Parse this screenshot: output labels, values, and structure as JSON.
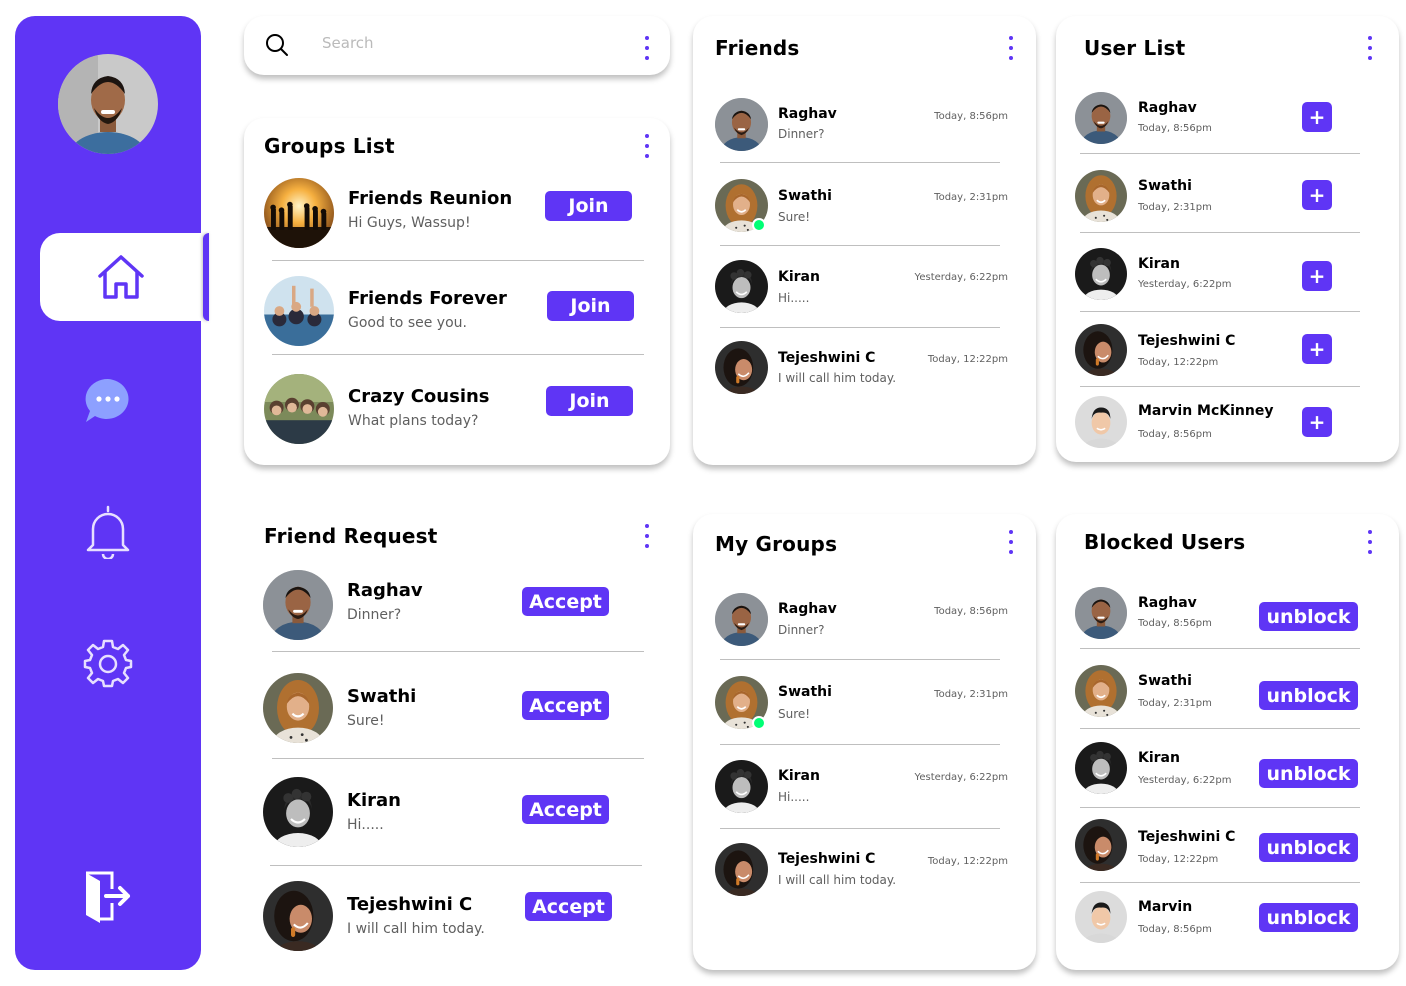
{
  "search": {
    "placeholder": "Search"
  },
  "groups_list": {
    "title": "Groups List",
    "items": [
      {
        "name": "Friends Reunion",
        "message": "Hi Guys, Wassup!",
        "action": "Join"
      },
      {
        "name": "Friends Forever",
        "message": "Good to see you.",
        "action": "Join"
      },
      {
        "name": "Crazy Cousins",
        "message": "What plans today?",
        "action": "Join"
      }
    ]
  },
  "friends": {
    "title": "Friends",
    "items": [
      {
        "name": "Raghav",
        "message": "Dinner?",
        "time": "Today, 8:56pm"
      },
      {
        "name": "Swathi",
        "message": "Sure!",
        "time": "Today, 2:31pm"
      },
      {
        "name": "Kiran",
        "message": "Hi.....",
        "time": "Yesterday, 6:22pm"
      },
      {
        "name": "Tejeshwini C",
        "message": "I will call him today.",
        "time": "Today, 12:22pm"
      }
    ]
  },
  "user_list": {
    "title": "User List",
    "items": [
      {
        "name": "Raghav",
        "time": "Today, 8:56pm",
        "action": "+"
      },
      {
        "name": "Swathi",
        "time": "Today, 2:31pm",
        "action": "+"
      },
      {
        "name": "Kiran",
        "time": "Yesterday, 6:22pm",
        "action": "+"
      },
      {
        "name": "Tejeshwini C",
        "time": "Today, 12:22pm",
        "action": "+"
      },
      {
        "name": "Marvin McKinney",
        "time": "Today, 8:56pm",
        "action": "+"
      }
    ]
  },
  "friend_request": {
    "title": "Friend  Request",
    "items": [
      {
        "name": "Raghav",
        "message": "Dinner?",
        "action": "Accept"
      },
      {
        "name": "Swathi",
        "message": "Sure!",
        "action": "Accept"
      },
      {
        "name": "Kiran",
        "message": "Hi.....",
        "action": "Accept"
      },
      {
        "name": "Tejeshwini C",
        "message": "I will call him today.",
        "action": "Accept"
      }
    ]
  },
  "my_groups": {
    "title": "My Groups",
    "items": [
      {
        "name": "Raghav",
        "message": "Dinner?",
        "time": "Today, 8:56pm"
      },
      {
        "name": "Swathi",
        "message": "Sure!",
        "time": "Today, 2:31pm"
      },
      {
        "name": "Kiran",
        "message": "Hi.....",
        "time": "Yesterday, 6:22pm"
      },
      {
        "name": "Tejeshwini C",
        "message": "I will call him today.",
        "time": "Today, 12:22pm"
      }
    ]
  },
  "blocked_users": {
    "title": "Blocked Users",
    "items": [
      {
        "name": "Raghav",
        "time": "Today, 8:56pm",
        "action": "unblock"
      },
      {
        "name": "Swathi",
        "time": "Today, 2:31pm",
        "action": "unblock"
      },
      {
        "name": "Kiran",
        "time": "Yesterday, 6:22pm",
        "action": "unblock"
      },
      {
        "name": "Tejeshwini C",
        "time": "Today, 12:22pm",
        "action": "unblock"
      },
      {
        "name": "Marvin",
        "time": "Today, 8:56pm",
        "action": "unblock"
      }
    ]
  },
  "colors": {
    "accent": "#5f35f5",
    "online": "#00ff75",
    "muted": "#5f5f5f"
  },
  "icons": [
    "home-icon",
    "chat-icon",
    "bell-icon",
    "gear-icon",
    "logout-icon",
    "search-icon"
  ]
}
